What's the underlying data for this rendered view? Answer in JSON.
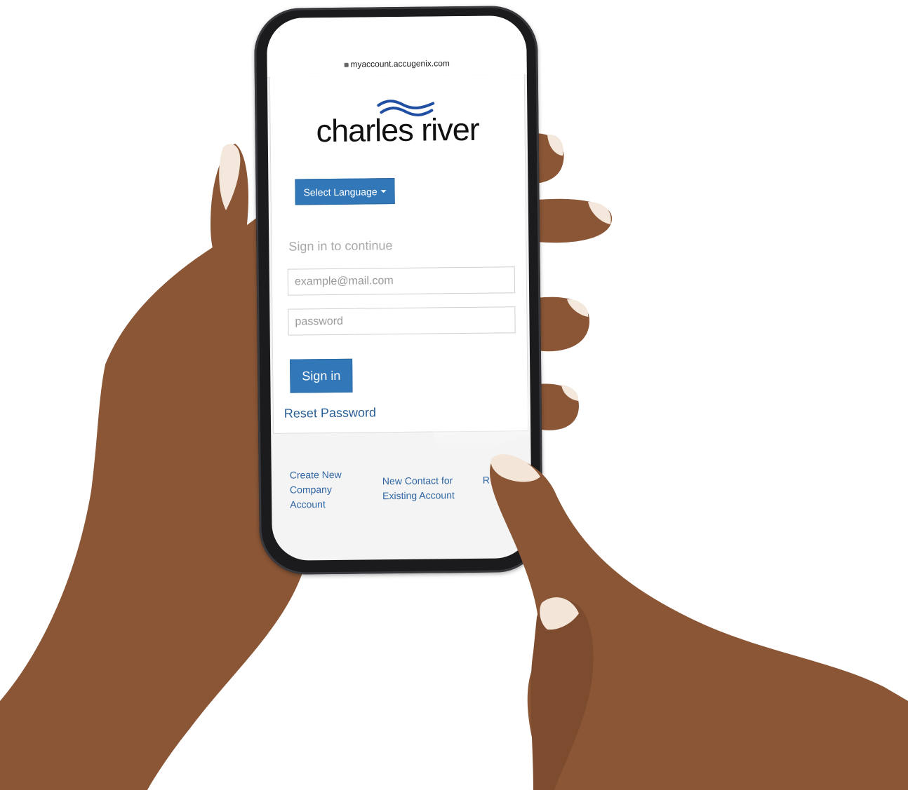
{
  "browser": {
    "url": "myaccount.accugenix.com"
  },
  "logo": {
    "text": "charles river"
  },
  "language": {
    "label": "Select Language"
  },
  "login": {
    "heading": "Sign in to continue",
    "email_placeholder": "example@mail.com",
    "password_placeholder": "password",
    "sign_in_label": "Sign in",
    "reset_label": "Reset Password"
  },
  "footer": {
    "links": [
      {
        "label": "Create New Company Account"
      },
      {
        "label": "New Contact for Existing Account"
      },
      {
        "label": "R a"
      }
    ]
  },
  "colors": {
    "primary": "#3278b8",
    "link": "#2a5f95",
    "logo_blue": "#1f4ea3",
    "skin": "#8a5636",
    "nail": "#f3e5d8"
  }
}
